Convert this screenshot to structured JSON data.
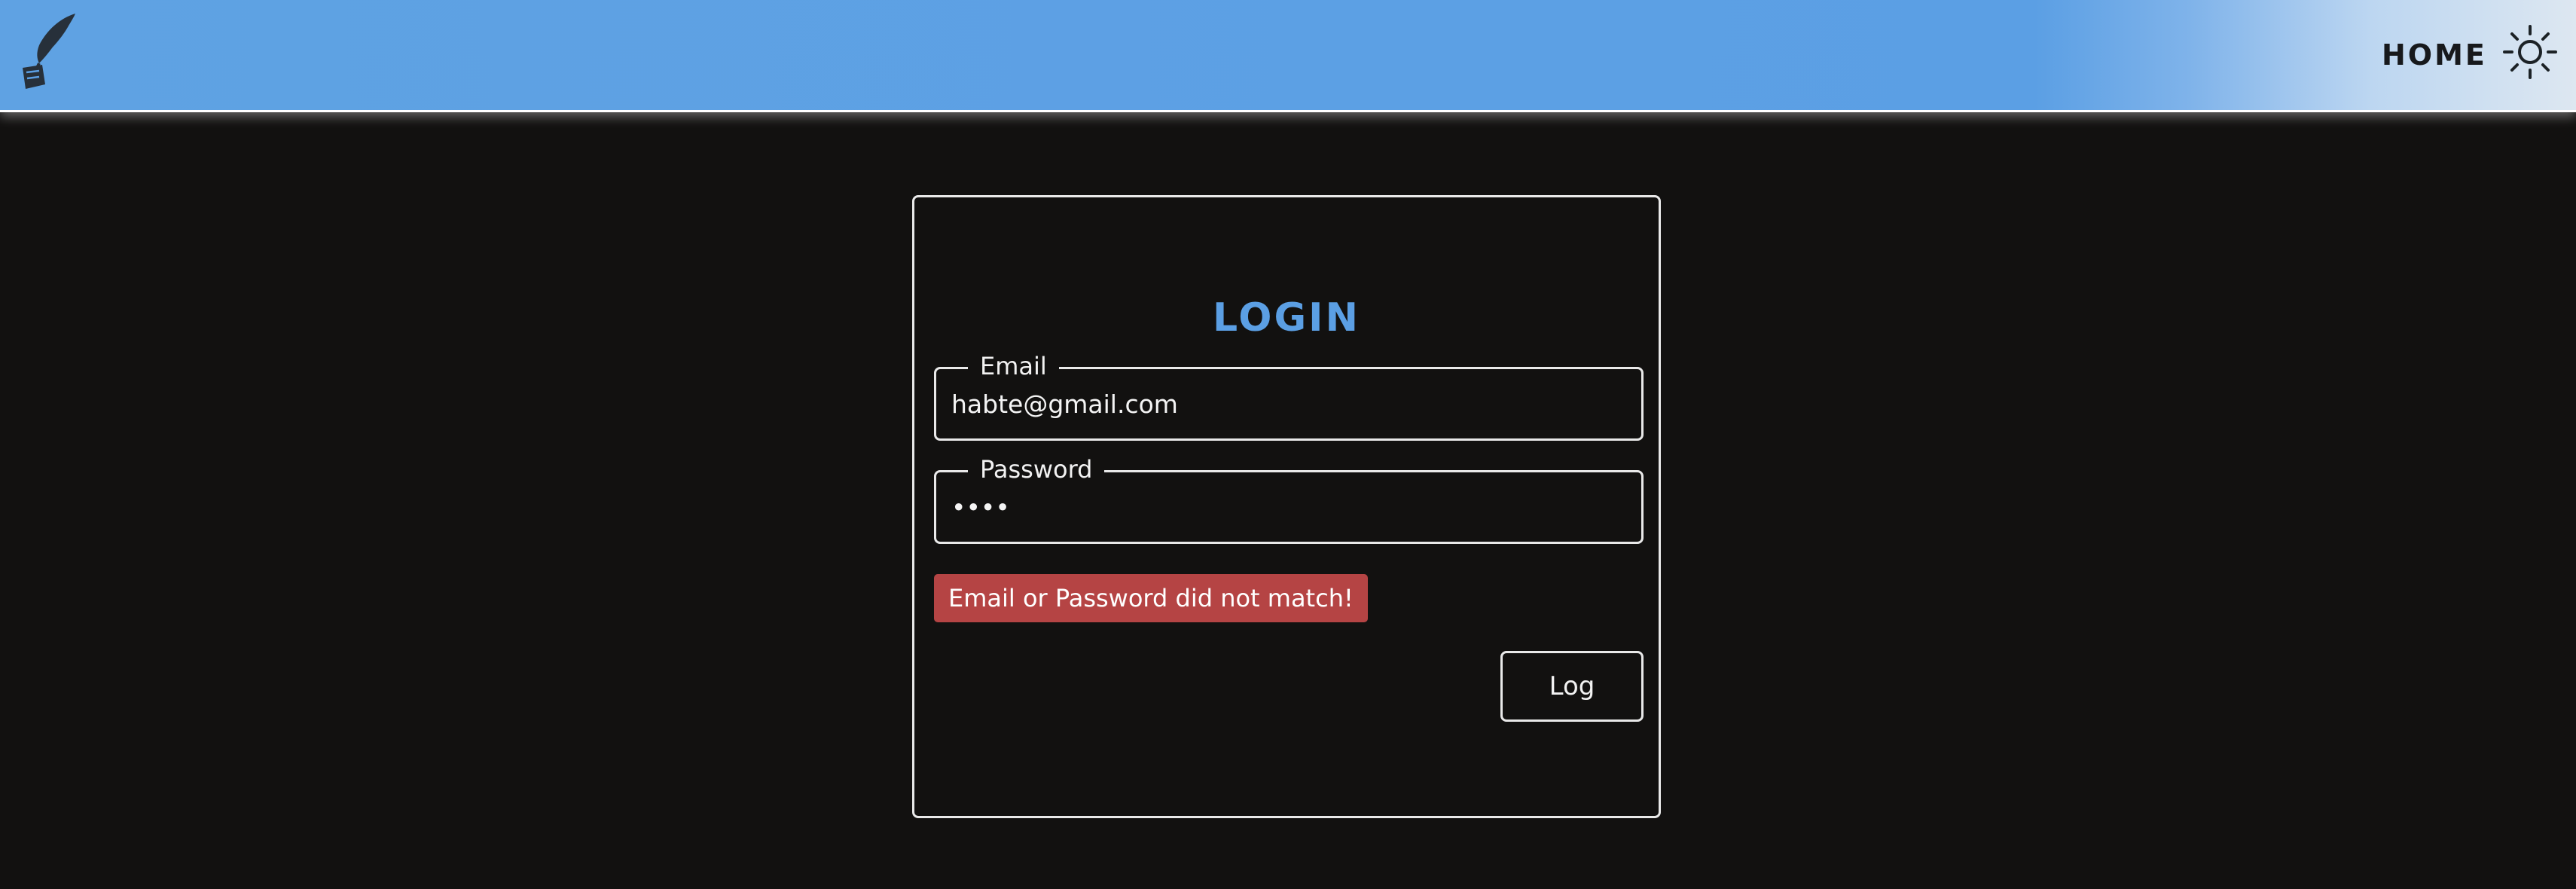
{
  "navbar": {
    "brand_icon": "quill-ink-icon",
    "home_label": "HOME",
    "theme_icon": "sun-icon",
    "colors": {
      "bar": "#5b9fe4",
      "fade_end": "#dde7f1",
      "text": "#17191c"
    }
  },
  "login": {
    "title": "LOGIN",
    "email": {
      "label": "Email",
      "value": "habte@gmail.com"
    },
    "password": {
      "label": "Password",
      "value": "abcd"
    },
    "error_message": "Email or Password did not match!",
    "submit_label": "Log",
    "colors": {
      "title": "#5b9fe4",
      "error_bg": "#b54444",
      "background": "#121110"
    }
  }
}
